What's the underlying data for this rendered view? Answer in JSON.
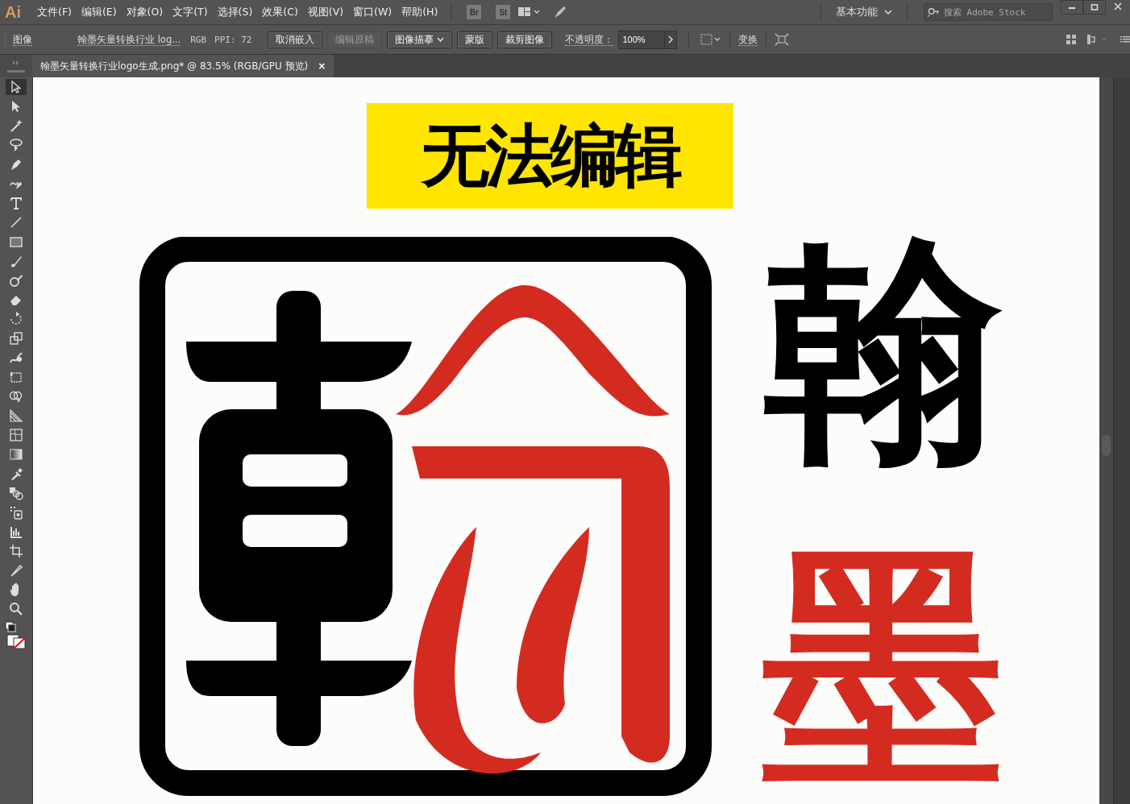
{
  "app": {
    "logo": "Ai"
  },
  "menu": [
    "文件(F)",
    "编辑(E)",
    "对象(O)",
    "文字(T)",
    "选择(S)",
    "效果(C)",
    "视图(V)",
    "窗口(W)",
    "帮助(H)"
  ],
  "bridge_buttons": [
    "Br",
    "St"
  ],
  "workspace": {
    "label": "基本功能"
  },
  "stock_search": {
    "placeholder": "搜索 Adobe Stock"
  },
  "control_bar": {
    "type_label": "图像",
    "file_name": "翰墨矢量转换行业 log...",
    "color_mode": "RGB",
    "ppi": "PPI: 72",
    "buttons": [
      {
        "label": "取消嵌入",
        "disabled": false
      },
      {
        "label": "编辑原稿",
        "disabled": true
      },
      {
        "label": "图像描摹",
        "disabled": false,
        "dropdown": true
      },
      {
        "label": "蒙版",
        "disabled": false
      },
      {
        "label": "裁剪图像",
        "disabled": false
      }
    ],
    "opacity_label": "不透明度：",
    "opacity_value": "100%",
    "transform_label": "变换"
  },
  "document_tab": {
    "title": "翰墨矢量转换行业logo生成.png* @ 83.5% (RGB/GPU 预览)",
    "close": "×"
  },
  "tools": [
    {
      "kind": "select",
      "selected": true
    },
    {
      "kind": "direct",
      "selected": false
    },
    {
      "kind": "wand",
      "selected": false
    },
    {
      "kind": "lasso",
      "selected": false
    },
    {
      "kind": "pen",
      "selected": false
    },
    {
      "kind": "curvature",
      "selected": false
    },
    {
      "kind": "type",
      "selected": false
    },
    {
      "kind": "line",
      "selected": false
    },
    {
      "kind": "rect",
      "selected": false
    },
    {
      "kind": "brush",
      "selected": false
    },
    {
      "kind": "blob",
      "selected": false
    },
    {
      "kind": "eraser",
      "selected": false
    },
    {
      "kind": "rotate",
      "selected": false
    },
    {
      "kind": "scale",
      "selected": false
    },
    {
      "kind": "warp",
      "selected": false
    },
    {
      "kind": "freetransform",
      "selected": false
    },
    {
      "kind": "shapebuilder",
      "selected": false
    },
    {
      "kind": "perspective",
      "selected": false
    },
    {
      "kind": "mesh",
      "selected": false
    },
    {
      "kind": "gradient",
      "selected": false
    },
    {
      "kind": "eyedropper",
      "selected": false
    },
    {
      "kind": "blend",
      "selected": false
    },
    {
      "kind": "symbol",
      "selected": false
    },
    {
      "kind": "graph",
      "selected": false
    },
    {
      "kind": "artboard",
      "selected": false
    },
    {
      "kind": "slice",
      "selected": false
    },
    {
      "kind": "hand",
      "selected": false
    },
    {
      "kind": "zoom",
      "selected": false
    }
  ],
  "artwork": {
    "banner": "无法编辑",
    "char_1": "翰",
    "char_2": "墨"
  }
}
